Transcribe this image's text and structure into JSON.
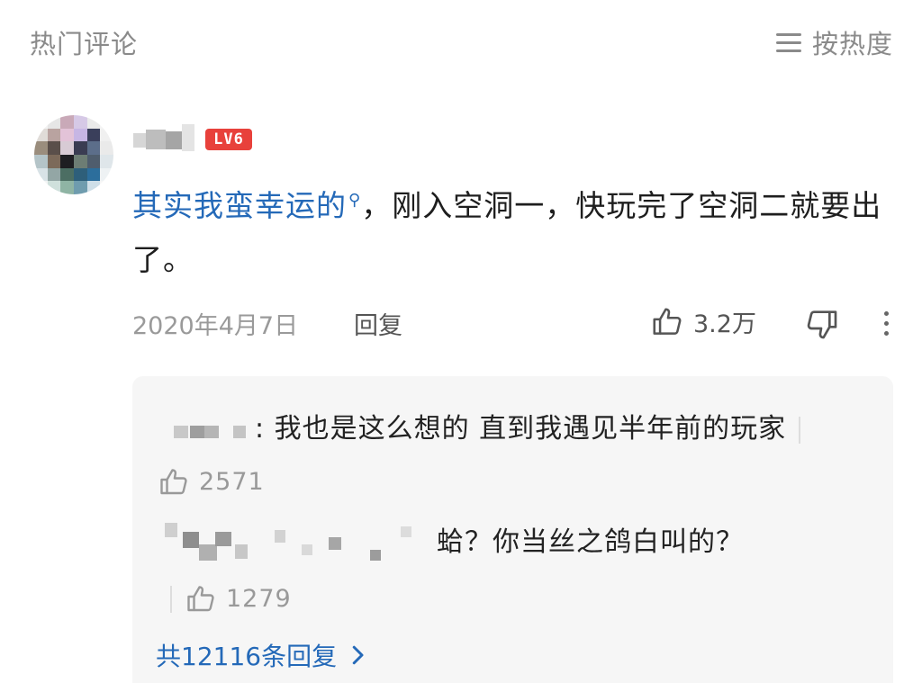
{
  "header": {
    "title": "热门评论",
    "sort_label": "按热度",
    "sort_icon": "menu-lines-icon"
  },
  "comment": {
    "level_badge": "LV6",
    "text_link": "其实我蛮幸运的",
    "text_rest": "，刚入空洞一，快玩完了空洞二就要出了。",
    "link_icon": "search-icon",
    "date": "2020年4月7日",
    "reply_label": "回复",
    "likes": "3.2万",
    "colors": {
      "link": "#2469b8",
      "badge": "#e8413b"
    }
  },
  "replies": [
    {
      "text": ": 我也是这么想的   直到我遇见半年前的玩家",
      "likes": "2571"
    },
    {
      "text": "蛤？你当丝之鸽白叫的？",
      "likes": "1279"
    }
  ],
  "view_all": "共12116条回复"
}
